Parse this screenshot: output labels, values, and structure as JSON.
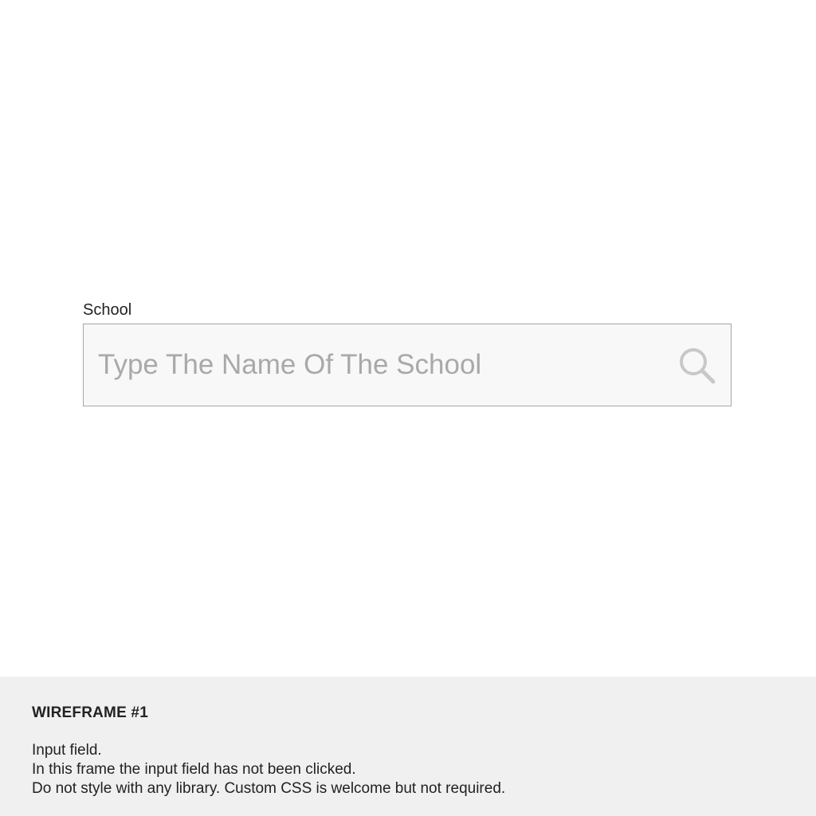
{
  "field": {
    "label": "School",
    "value": "",
    "placeholder": "Type The Name Of The School",
    "icon": "search-icon"
  },
  "footer": {
    "title": "WIREFRAME #1",
    "lines": [
      "Input field.",
      "In this frame the input field has not been clicked.",
      "Do not style with any library. Custom CSS is welcome but not required."
    ]
  },
  "colors": {
    "field_border": "#a6a6a6",
    "field_background": "#f8f8f8",
    "placeholder_text": "#a9a9a9",
    "icon": "#c8c8c8",
    "footer_background": "#f0f0f0"
  }
}
